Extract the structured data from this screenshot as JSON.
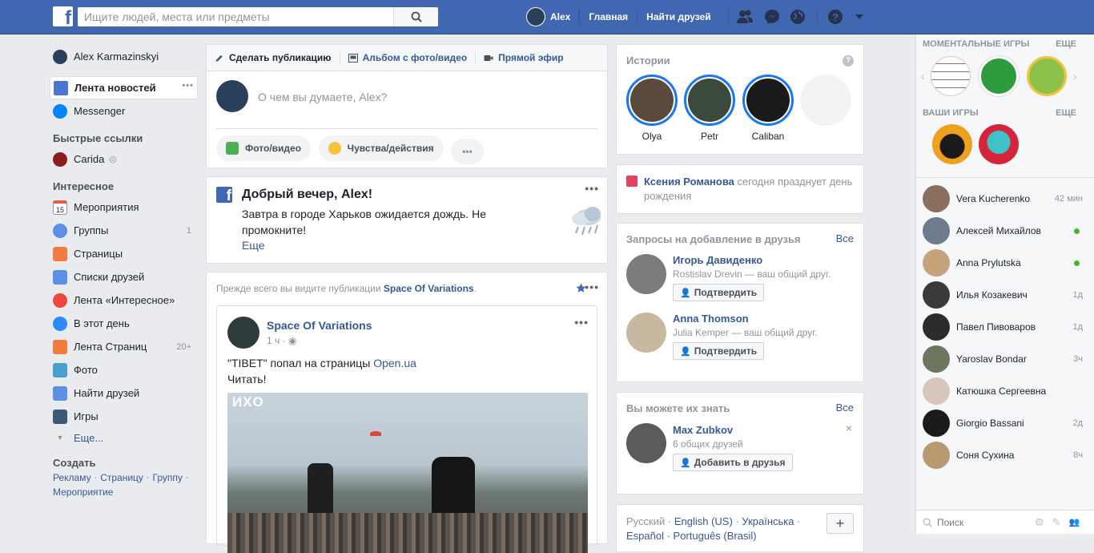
{
  "topbar": {
    "logo": "f",
    "search_placeholder": "Ищите людей, места или предметы",
    "profile_name": "Alex",
    "home": "Главная",
    "find_friends": "Найти друзей"
  },
  "left": {
    "user_name": "Alex Karmazinskyi",
    "news_feed": "Лента новостей",
    "messenger": "Messenger",
    "shortcuts_title": "Быстрые ссылки",
    "shortcut_carida": "Carida",
    "explore_title": "Интересное",
    "explore": [
      {
        "label": "Мероприятия",
        "count": "",
        "icon_text": "15"
      },
      {
        "label": "Группы",
        "count": "1"
      },
      {
        "label": "Страницы",
        "count": ""
      },
      {
        "label": "Списки друзей",
        "count": ""
      },
      {
        "label": "Лента «Интересное»",
        "count": ""
      },
      {
        "label": "В этот день",
        "count": ""
      },
      {
        "label": "Лента Страниц",
        "count": "20+"
      },
      {
        "label": "Фото",
        "count": ""
      },
      {
        "label": "Найти друзей",
        "count": ""
      },
      {
        "label": "Игры",
        "count": ""
      }
    ],
    "more": "Еще...",
    "create_title": "Создать",
    "create_links": [
      "Рекламу",
      "Страницу",
      "Группу",
      "Мероприятие"
    ],
    "separator": "·"
  },
  "composer": {
    "tab_post": "Сделать публикацию",
    "tab_album": "Альбом с фото/видео",
    "tab_live": "Прямой эфир",
    "placeholder": "О чем вы думаете, Alex?",
    "photo_video": "Фото/видео",
    "feeling": "Чувства/действия",
    "more": "•••"
  },
  "greeting": {
    "title": "Добрый вечер, Alex!",
    "text": "Завтра в городе Харьков ожидается дождь. Не промокните!",
    "more": "Еще",
    "menu": "•••"
  },
  "post": {
    "see_first_prefix": "Прежде всего вы видите публикации",
    "see_first_page": "Space Of Variations",
    "see_first_suffix": ".",
    "menu": "•••",
    "author": "Space Of Variations",
    "time": "1 ч",
    "separator": "·",
    "text_line1_prefix": "\"TIBET\" попал на страницы",
    "text_link": "Open.ua",
    "text_line2": "Читать!",
    "image_logo": "ИXO"
  },
  "stories": {
    "title": "Истории",
    "help": "?",
    "items": [
      {
        "name": "Olya"
      },
      {
        "name": "Petr"
      },
      {
        "name": "Caliban"
      }
    ]
  },
  "birthday": {
    "name": "Ксения Романова",
    "text": "сегодня празднует день рождения"
  },
  "friend_requests": {
    "title": "Запросы на добавление в друзья",
    "all": "Все",
    "items": [
      {
        "name": "Игорь Давиденко",
        "mutual": "Rostislav Drevin — ваш общий друг.",
        "button": "Подтвердить"
      },
      {
        "name": "Anna Thomson",
        "mutual": "Julia Kemper — ваш общий друг.",
        "button": "Подтвердить"
      }
    ]
  },
  "people_you_may_know": {
    "title": "Вы можете их знать",
    "all": "Все",
    "close": "×",
    "name": "Max Zubkov",
    "mutual": "6 общих друзей",
    "button": "Добавить в друзья"
  },
  "languages": {
    "items": [
      "Русский",
      "English (US)",
      "Українська"
    ],
    "row2": "Español · Português (Brasil)",
    "separator": "·",
    "add": "+"
  },
  "chat": {
    "instant_games": "МОМЕНТАЛЬНЫЕ ИГРЫ",
    "your_games": "ВАШИ ИГРЫ",
    "more": "ЕЩЕ",
    "search_placeholder": "Поиск",
    "contacts": [
      {
        "name": "Vera Kucherenko",
        "status": "42 мин",
        "online": false
      },
      {
        "name": "Алексей Михайлов",
        "status": "",
        "online": true
      },
      {
        "name": "Anna Prylutska",
        "status": "",
        "online": true
      },
      {
        "name": "Илья Козакевич",
        "status": "1д",
        "online": false
      },
      {
        "name": "Павел Пивоваров",
        "status": "1д",
        "online": false
      },
      {
        "name": "Yaroslav Bondar",
        "status": "3ч",
        "online": false
      },
      {
        "name": "Катюшка Сергеевна",
        "status": "",
        "online": false
      },
      {
        "name": "Giorgio Bassani",
        "status": "2д",
        "online": false
      },
      {
        "name": "Соня Сухина",
        "status": "8ч",
        "online": false
      }
    ]
  },
  "colors": {
    "brand": "#4267b2",
    "link": "#365899",
    "online": "#42b72a",
    "background": "#e9ebee"
  }
}
